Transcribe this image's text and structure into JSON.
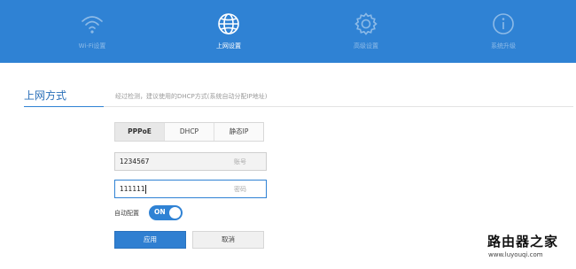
{
  "nav": {
    "items": [
      {
        "label": "Wi-Fi设置",
        "icon": "wifi-icon",
        "active": false
      },
      {
        "label": "上网设置",
        "icon": "globe-icon",
        "active": true
      },
      {
        "label": "高级设置",
        "icon": "gear-icon",
        "active": false
      },
      {
        "label": "系统升级",
        "icon": "info-icon",
        "active": false
      }
    ]
  },
  "section": {
    "title": "上网方式",
    "hint": "经过检测，建议使用的DHCP方式(系统自动分配IP地址)"
  },
  "tabs": [
    {
      "label": "PPPoE",
      "active": true
    },
    {
      "label": "DHCP",
      "active": false
    },
    {
      "label": "静态IP",
      "active": false
    }
  ],
  "account": {
    "value": "1234567",
    "label": "账号"
  },
  "password": {
    "value": "111111",
    "label": "密码"
  },
  "auto_config": {
    "label": "自动配置",
    "state": "ON"
  },
  "buttons": {
    "apply": "应用",
    "cancel": "取消"
  },
  "watermark": {
    "title": "路由器之家",
    "url": "www.luyouqi.com"
  },
  "colors": {
    "brand_blue": "#2f82d4"
  }
}
